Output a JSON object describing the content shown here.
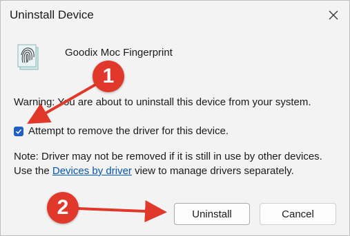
{
  "window": {
    "title": "Uninstall Device",
    "close_icon": "close-icon"
  },
  "device": {
    "icon": "fingerprint-icon",
    "name": "Goodix Moc Fingerprint"
  },
  "warning_text": "Warning: You are about to uninstall this device from your system.",
  "checkbox": {
    "checked": true,
    "label": "Attempt to remove the driver for this device."
  },
  "note": {
    "before_link": "Note: Driver may not be removed if it is still in use by other devices. Use the ",
    "link_text": "Devices by driver",
    "after_link": " view to manage drivers separately."
  },
  "buttons": {
    "uninstall_label": "Uninstall",
    "cancel_label": "Cancel"
  },
  "annotations": {
    "badge_1": "1",
    "badge_2": "2",
    "color": "#e0392b"
  }
}
